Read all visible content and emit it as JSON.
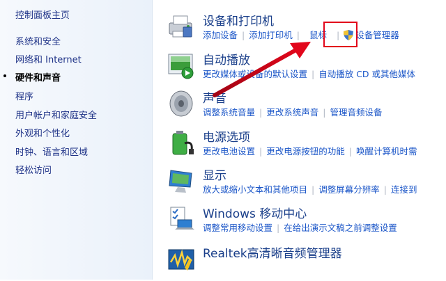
{
  "sidebar": {
    "items": [
      {
        "label": "控制面板主页"
      },
      {
        "label": "系统和安全"
      },
      {
        "label": "网络和 Internet"
      },
      {
        "label": "硬件和声音"
      },
      {
        "label": "程序"
      },
      {
        "label": "用户帐户和家庭安全"
      },
      {
        "label": "外观和个性化"
      },
      {
        "label": "时钟、语言和区域"
      },
      {
        "label": "轻松访问"
      }
    ],
    "active": "硬件和声音"
  },
  "categories": [
    {
      "title": "设备和打印机",
      "icon": "printer-icon",
      "links": [
        "添加设备",
        "添加打印机",
        "鼠标",
        "设备管理器"
      ]
    },
    {
      "title": "自动播放",
      "icon": "autoplay-icon",
      "links": [
        "更改媒体或设备的默认设置",
        "自动播放 CD 或其他媒体"
      ]
    },
    {
      "title": "声音",
      "icon": "speaker-icon",
      "links": [
        "调整系统音量",
        "更改系统声音",
        "管理音频设备"
      ]
    },
    {
      "title": "电源选项",
      "icon": "battery-icon",
      "links": [
        "更改电池设置",
        "更改电源按钮的功能",
        "唤醒计算机时需"
      ]
    },
    {
      "title": "显示",
      "icon": "display-icon",
      "links": [
        "放大或缩小文本和其他项目",
        "调整屏幕分辨率",
        "连接到"
      ]
    },
    {
      "title": "Windows 移动中心",
      "icon": "mobility-center-icon",
      "links": [
        "调整常用移动设置",
        "在给出演示文稿之前调整设置"
      ]
    },
    {
      "title": "Realtek高清晰音频管理器",
      "icon": "realtek-audio-icon",
      "links": []
    }
  ],
  "colors": {
    "highlight": "#e2061b",
    "link": "#1b56c8",
    "title": "#1a3f8a"
  }
}
